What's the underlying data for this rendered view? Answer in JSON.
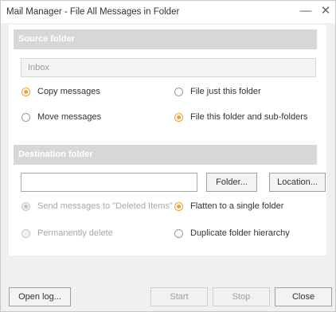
{
  "window": {
    "title": "Mail Manager - File All Messages in Folder",
    "minimize_glyph": "—",
    "close_glyph": "✕"
  },
  "source": {
    "header": "Source folder",
    "folder_value": "Inbox",
    "copy_label": "Copy messages",
    "move_label": "Move messages",
    "file_just_label": "File just this folder",
    "file_sub_label": "File this folder and sub-folders",
    "selected_action": "copy",
    "selected_scope": "subfolders"
  },
  "destination": {
    "header": "Destination folder",
    "folder_input_value": "",
    "folder_button": "Folder...",
    "location_button": "Location...",
    "send_deleted_label": "Send messages to \"Deleted Items\"",
    "perm_delete_label": "Permanently delete",
    "flatten_label": "Flatten to a single folder",
    "duplicate_label": "Duplicate folder hierarchy"
  },
  "footer": {
    "open_log": "Open log...",
    "start": "Start",
    "stop": "Stop",
    "close": "Close"
  },
  "colors": {
    "accent": "#f0a030",
    "header_bg": "#d7d7d7",
    "panel_bg": "#ffffff",
    "window_bg": "#f0f0f0"
  }
}
